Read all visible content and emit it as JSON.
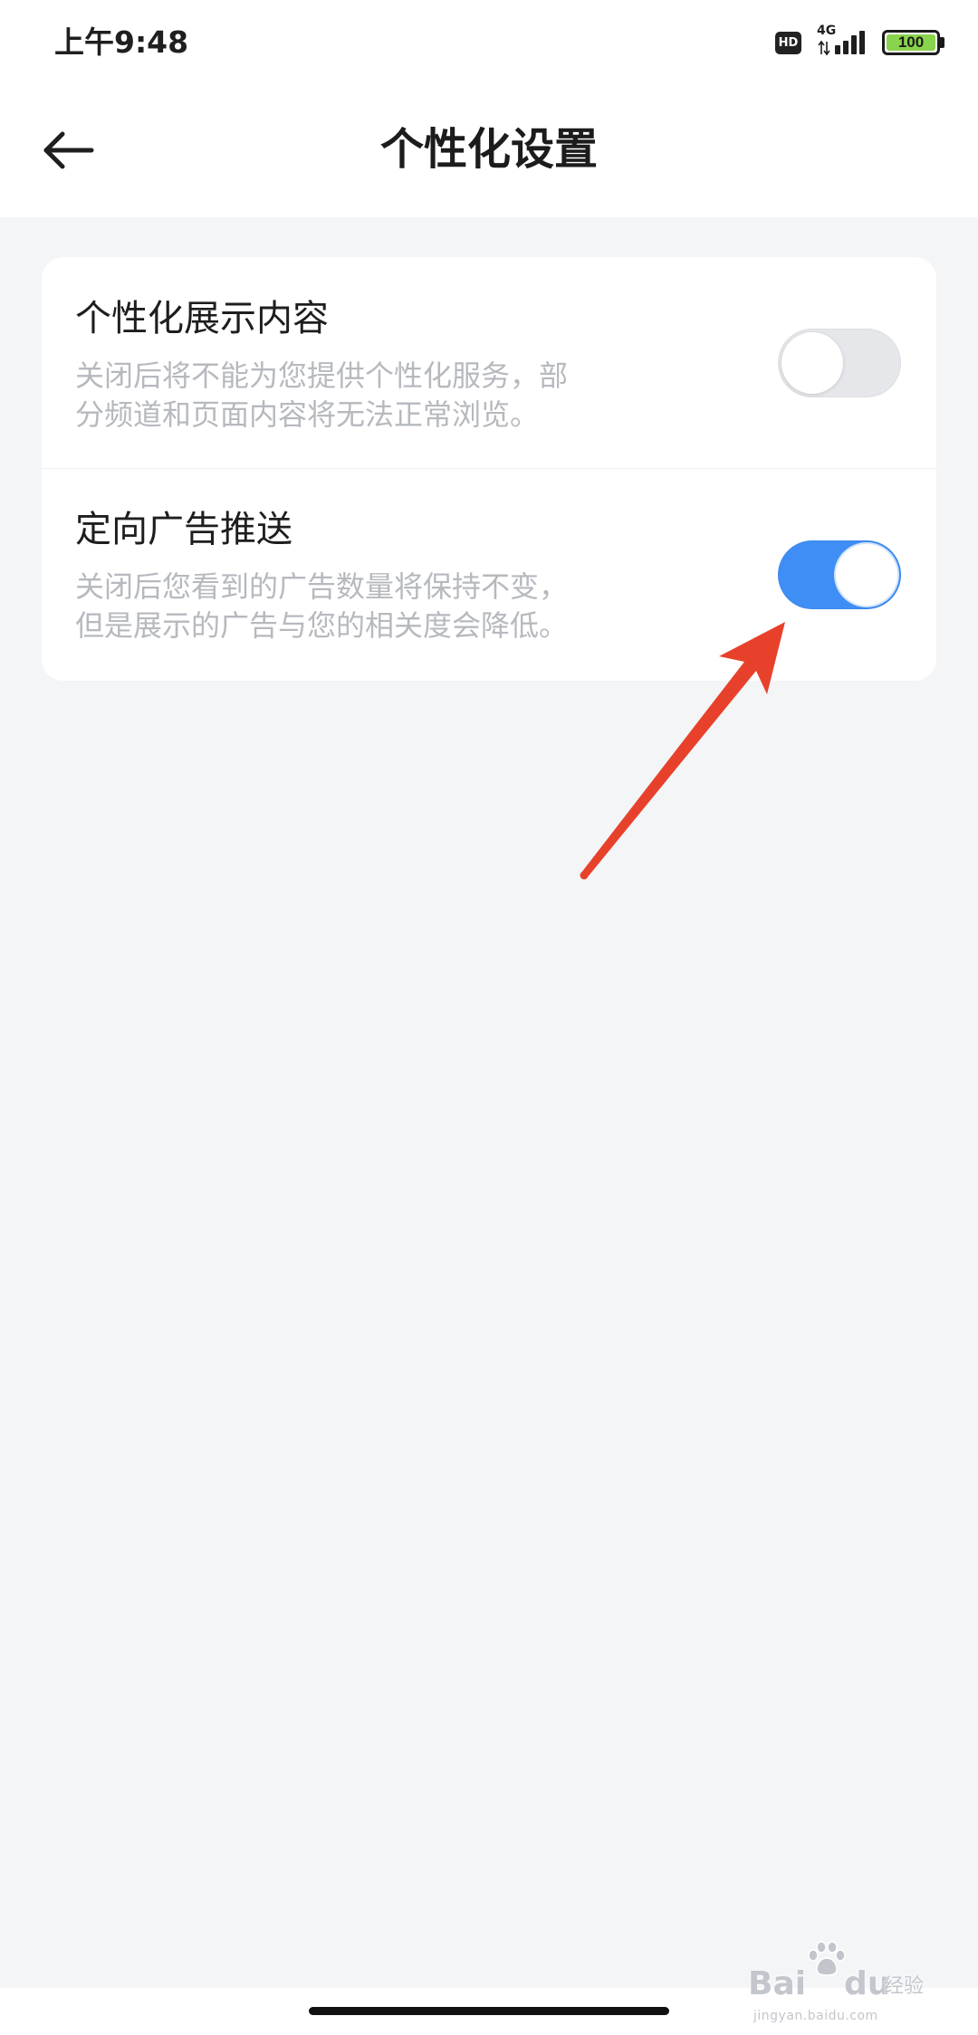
{
  "status_bar": {
    "time": "上午9:48",
    "hd_badge": "HD",
    "network": "4G",
    "battery_level": "100",
    "icons": {
      "data_activity": "data-arrows-icon",
      "signal": "signal-bars-icon",
      "battery": "battery-icon"
    }
  },
  "header": {
    "title": "个性化设置",
    "back_icon": "arrow-left-icon"
  },
  "settings": [
    {
      "title": "个性化展示内容",
      "description": "关闭后将不能为您提供个性化服务，部分频道和页面内容将无法正常浏览。",
      "enabled": false
    },
    {
      "title": "定向广告推送",
      "description": "关闭后您看到的广告数量将保持不变，但是展示的广告与您的相关度会降低。",
      "enabled": true
    }
  ],
  "annotation": {
    "arrow_color": "#e8412b",
    "points_to": "定向广告推送"
  },
  "watermark": {
    "brand_left": "Bai",
    "brand_right": "du",
    "brand_cn": "经验",
    "url": "jingyan.baidu.com",
    "icon": "baidu-paw-icon"
  },
  "colors": {
    "page_background": "#f3f5f7",
    "toggle_on": "#3f8ef5",
    "toggle_off": "#e5e7ea",
    "battery_fill": "#8ad34d"
  }
}
